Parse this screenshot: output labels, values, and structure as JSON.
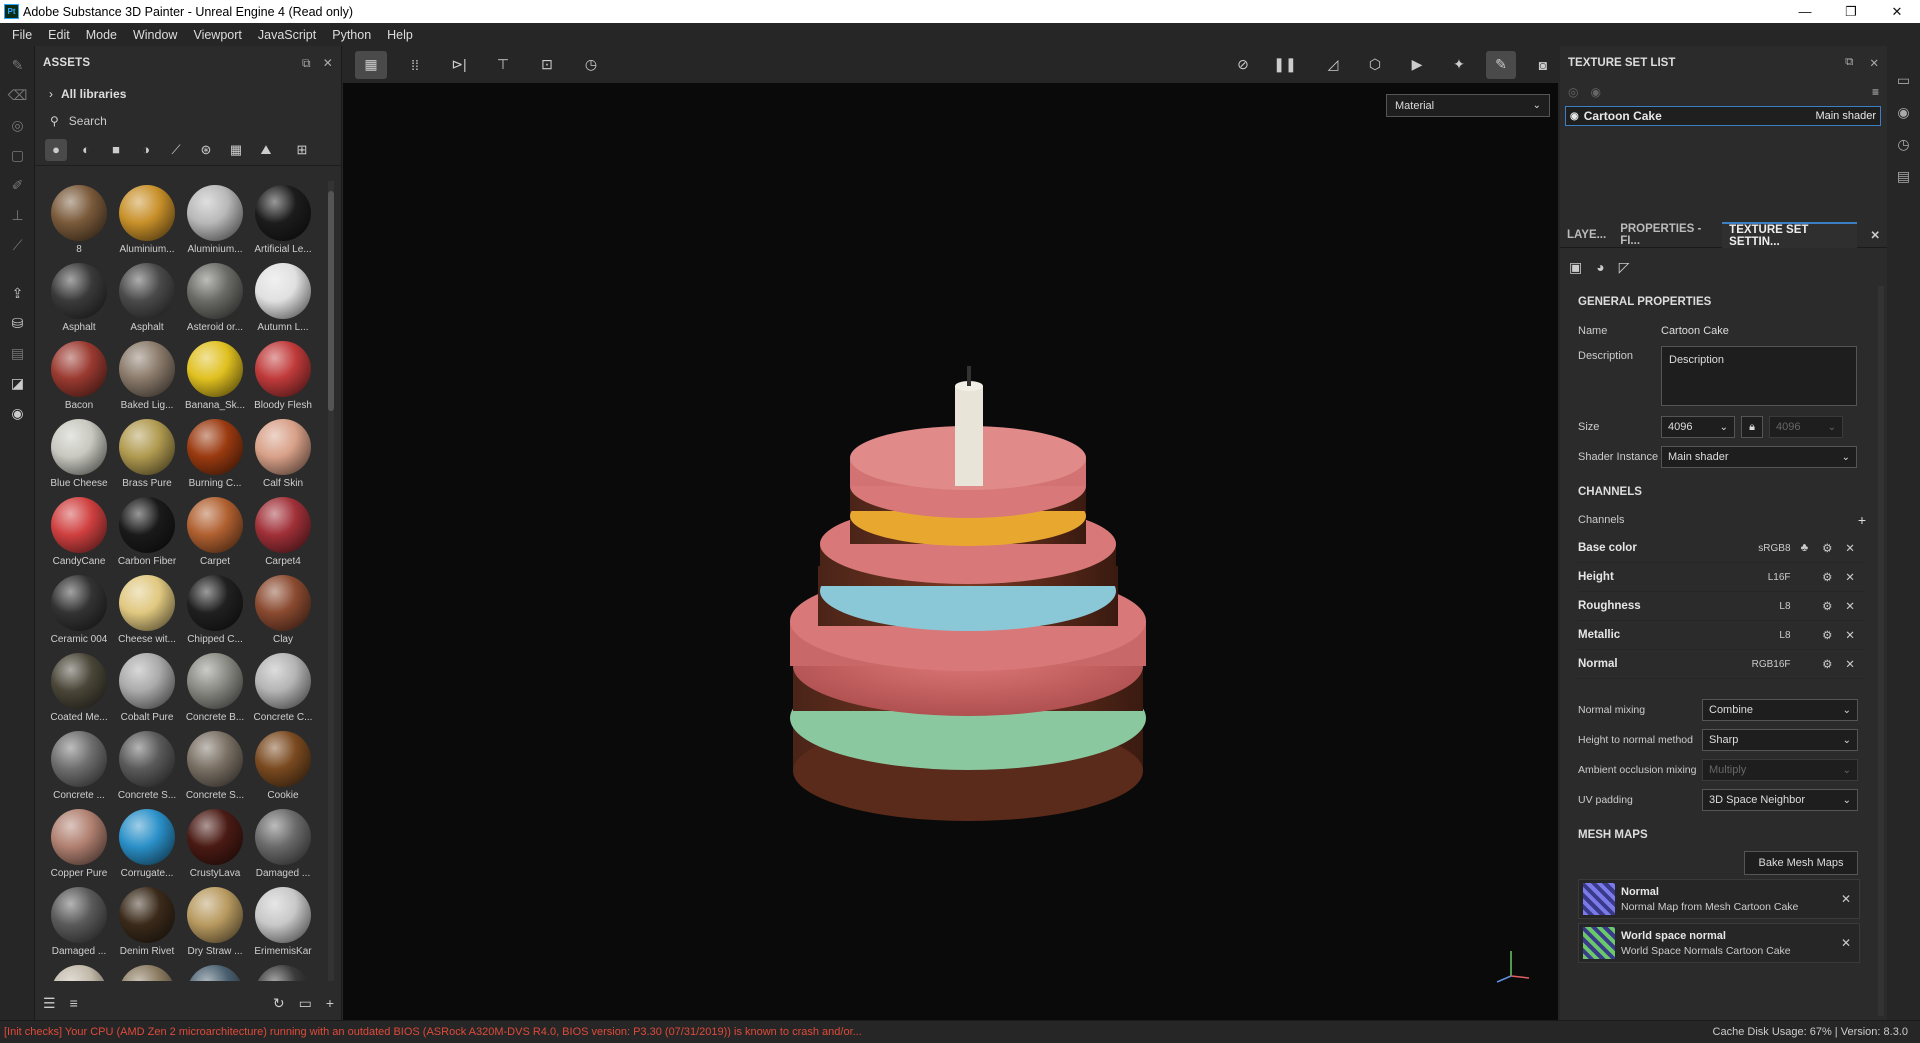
{
  "window": {
    "title": "Adobe Substance 3D Painter - Unreal Engine 4 (Read only)",
    "logo": "Pt"
  },
  "menu": [
    "File",
    "Edit",
    "Mode",
    "Window",
    "Viewport",
    "JavaScript",
    "Python",
    "Help"
  ],
  "assets": {
    "title": "ASSETS",
    "library": "All libraries",
    "search_placeholder": "Search",
    "items": [
      {
        "label": "8",
        "color": "#7a5a3a"
      },
      {
        "label": "Aluminium...",
        "color": "#c8902a"
      },
      {
        "label": "Aluminium...",
        "color": "#b8b8b8"
      },
      {
        "label": "Artificial Le...",
        "color": "#1c1c1c"
      },
      {
        "label": "Asphalt",
        "color": "#3a3a3a"
      },
      {
        "label": "Asphalt",
        "color": "#4a4a4a"
      },
      {
        "label": "Asteroid or...",
        "color": "#6a6a66"
      },
      {
        "label": "Autumn L...",
        "color": "#e0e0e0"
      },
      {
        "label": "Bacon",
        "color": "#9a3a30"
      },
      {
        "label": "Baked Lig...",
        "color": "#8a7a6a"
      },
      {
        "label": "Banana_Sk...",
        "color": "#e0c020"
      },
      {
        "label": "Bloody Flesh",
        "color": "#c03a3a"
      },
      {
        "label": "Blue Cheese",
        "color": "#c8c8c0"
      },
      {
        "label": "Brass Pure",
        "color": "#b09a50"
      },
      {
        "label": "Burning C...",
        "color": "#9a3a10"
      },
      {
        "label": "Calf Skin",
        "color": "#d8a088"
      },
      {
        "label": "CandyCane",
        "color": "#d04040"
      },
      {
        "label": "Carbon Fiber",
        "color": "#1a1a1a"
      },
      {
        "label": "Carpet",
        "color": "#b06030"
      },
      {
        "label": "Carpet4",
        "color": "#a03038"
      },
      {
        "label": "Ceramic 004",
        "color": "#333333"
      },
      {
        "label": "Cheese wit...",
        "color": "#e0c880"
      },
      {
        "label": "Chipped C...",
        "color": "#202020"
      },
      {
        "label": "Clay",
        "color": "#8a4a30"
      },
      {
        "label": "Coated Me...",
        "color": "#4a4638"
      },
      {
        "label": "Cobalt Pure",
        "color": "#aaaaaa"
      },
      {
        "label": "Concrete B...",
        "color": "#8a8a84"
      },
      {
        "label": "Concrete C...",
        "color": "#b4b4b4"
      },
      {
        "label": "Concrete ...",
        "color": "#6e6e6e"
      },
      {
        "label": "Concrete S...",
        "color": "#5a5a5a"
      },
      {
        "label": "Concrete S...",
        "color": "#7a7064"
      },
      {
        "label": "Cookie",
        "color": "#7a4a20"
      },
      {
        "label": "Copper Pure",
        "color": "#b08070"
      },
      {
        "label": "Corrugate...",
        "color": "#2a90c8"
      },
      {
        "label": "CrustyLava",
        "color": "#4a1a14"
      },
      {
        "label": "Damaged ...",
        "color": "#6a6a6a"
      },
      {
        "label": "Damaged ...",
        "color": "#5a5a5a"
      },
      {
        "label": "Denim Rivet",
        "color": "#3a2a1a"
      },
      {
        "label": "Dry Straw ...",
        "color": "#b89a60"
      },
      {
        "label": "ErimemisKar",
        "color": "#c8c8c8"
      },
      {
        "label": "",
        "color": "#c0b8a8"
      },
      {
        "label": "",
        "color": "#8a7a60"
      },
      {
        "label": "",
        "color": "#4a6070"
      },
      {
        "label": "",
        "color": "#3a3a3a"
      }
    ]
  },
  "viewport": {
    "material_select": "Material"
  },
  "texture_set_list": {
    "title": "TEXTURE SET LIST",
    "set_name": "Cartoon Cake",
    "shader": "Main shader"
  },
  "tabs": {
    "layers": "LAYE...",
    "properties": "PROPERTIES - FI...",
    "texture_set": "TEXTURE SET SETTIN..."
  },
  "general": {
    "heading": "GENERAL PROPERTIES",
    "name_label": "Name",
    "name_value": "Cartoon Cake",
    "description_label": "Description",
    "description_value": "Description",
    "size_label": "Size",
    "size_value": "4096",
    "size_value2": "4096",
    "shader_label": "Shader Instance",
    "shader_value": "Main shader"
  },
  "channels": {
    "heading": "CHANNELS",
    "label": "Channels",
    "items": [
      {
        "name": "Base color",
        "format": "sRGB8"
      },
      {
        "name": "Height",
        "format": "L16F"
      },
      {
        "name": "Roughness",
        "format": "L8"
      },
      {
        "name": "Metallic",
        "format": "L8"
      },
      {
        "name": "Normal",
        "format": "RGB16F"
      }
    ]
  },
  "settings": [
    {
      "label": "Normal mixing",
      "value": "Combine"
    },
    {
      "label": "Height to normal method",
      "value": "Sharp"
    },
    {
      "label": "Ambient occlusion mixing",
      "value": "Multiply"
    },
    {
      "label": "UV padding",
      "value": "3D Space Neighbor"
    }
  ],
  "mesh_maps": {
    "heading": "MESH MAPS",
    "bake_button": "Bake Mesh Maps",
    "items": [
      {
        "title": "Normal",
        "subtitle": "Normal Map from Mesh Cartoon Cake",
        "color": "#7a7ae8"
      },
      {
        "title": "World space normal",
        "subtitle": "World Space Normals Cartoon Cake",
        "color": "#6ac86a"
      }
    ]
  },
  "status": {
    "error": "[Init checks] Your CPU (AMD Zen 2 microarchitecture) running with an outdated BIOS (ASRock A320M-DVS R4.0, BIOS version: P3.30 (07/31/2019)) is known to crash and/or...",
    "cache": "Cache Disk Usage:   67% | Version: 8.3.0"
  }
}
